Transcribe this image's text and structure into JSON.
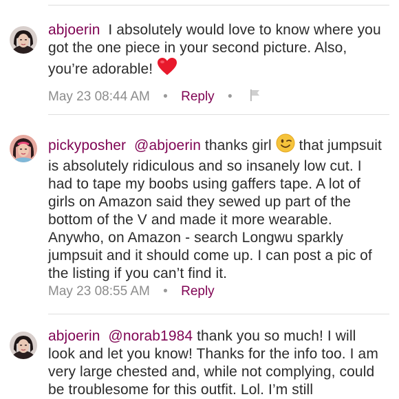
{
  "comments": [
    {
      "username": "abjoerin",
      "mention": "",
      "text": "I absolutely would love to know where you got the one piece in your second picture. Also, you’re adorable!",
      "emoji": "heart",
      "timestamp": "May 23 08:44 AM",
      "reply_label": "Reply",
      "avatar_icon": "avatar-dark-hair"
    },
    {
      "username": "pickyposher",
      "mention": "@abjoerin",
      "text_before": "thanks girl",
      "emoji": "winking-face",
      "text": "that jumpsuit is absolutely ridiculous and so insanely low cut.  I had to tape my boobs using gaffers tape.  A lot of girls on Amazon said they sewed up part of the bottom of the V and made it more wearable.  Anywho, on Amazon - search Longwu sparkly jumpsuit and it should come up.  I can post a pic of the listing if you can’t find it.",
      "timestamp": "May 23 08:55 AM",
      "reply_label": "Reply",
      "avatar_icon": "avatar-pink-hair"
    },
    {
      "username": "abjoerin",
      "mention": "@norab1984",
      "text": "thank you so much! I will look and let you know! Thanks for the info too. I am very large chested and, while not complying, could be troublesome for this outfit. Lol. I’m still",
      "avatar_icon": "avatar-dark-hair"
    }
  ],
  "colors": {
    "accent": "#7f0353",
    "meta": "#8c8c8c",
    "divider": "#dedede",
    "heart": "#e8192c",
    "emoji": "#f5c33b"
  }
}
